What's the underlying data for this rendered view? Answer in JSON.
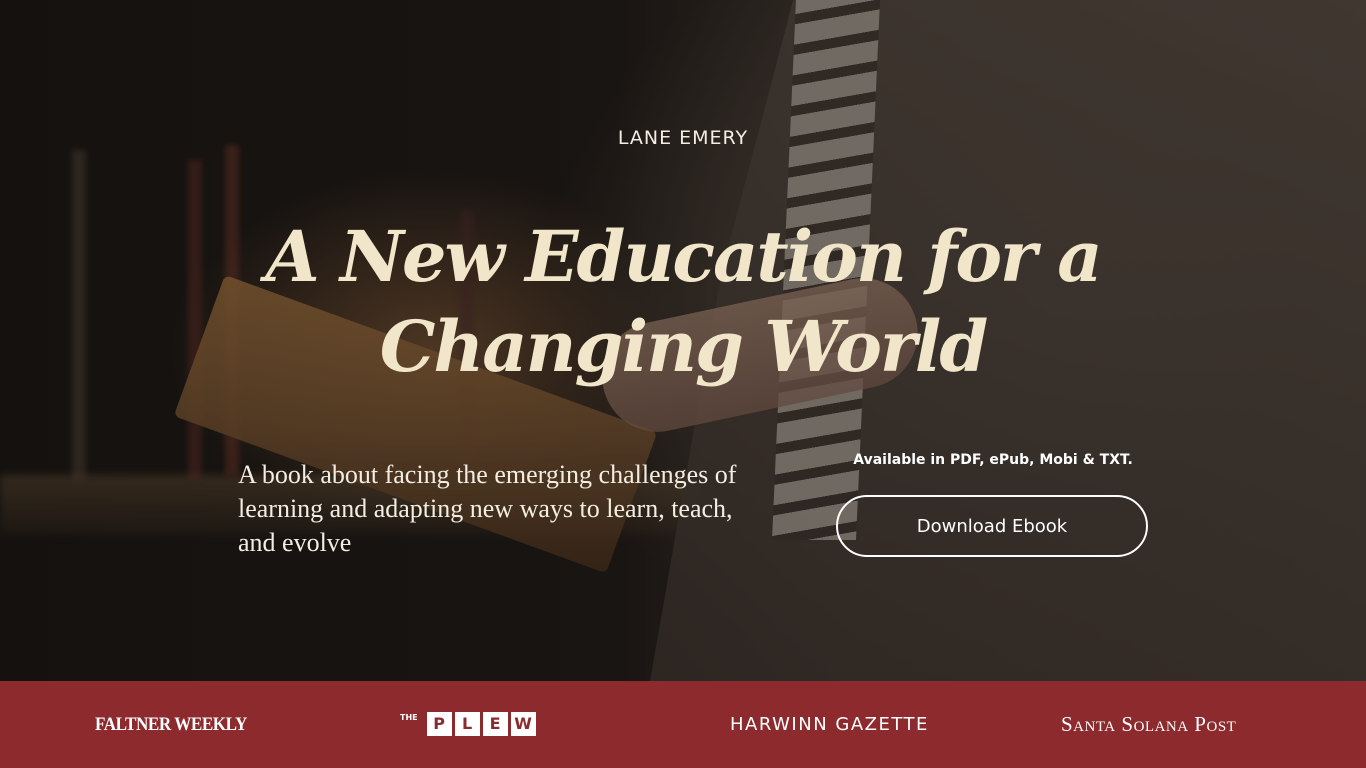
{
  "hero": {
    "author": "LANE EMERY",
    "title": "A New Education for a Changing World",
    "tagline": "A book about facing the emerging challenges of learning and adapting new ways to learn, teach, and evolve",
    "formats": "Available in PDF, ePub, Mobi & TXT.",
    "download_label": "Download Ebook"
  },
  "press": {
    "items": [
      "FALTNER WEEKLY",
      {
        "prefix": "THE",
        "letters": [
          "P",
          "L",
          "E",
          "W"
        ]
      },
      "HARWINN GAZETTE",
      "Santa Solana Post"
    ]
  },
  "colors": {
    "title": "#f1e6c9",
    "press_bar": "#8c2a2d",
    "text": "#ffffff"
  }
}
